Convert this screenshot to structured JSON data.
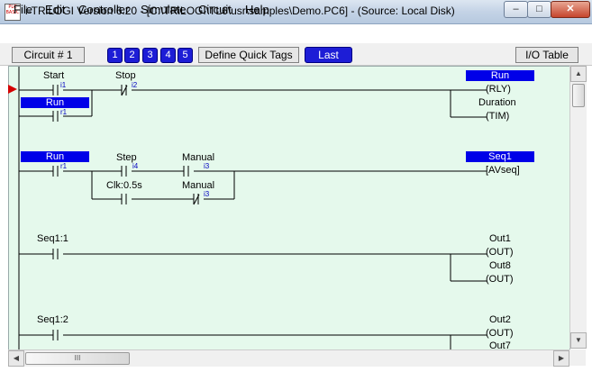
{
  "window": {
    "title": "i-TRiLOGI Version 6.20 - [C:\\TRiLOGI\\TL6\\usr\\samples\\Demo.PC6] - (Source: Local Disk)",
    "icon_text": "PLC BASIC",
    "minimize": "–",
    "maximize": "□",
    "close": "✕"
  },
  "menu": [
    "File",
    "Edit",
    "Controller",
    "Simulate",
    "Circuit",
    "Help"
  ],
  "toolbar": {
    "circuit_label": "Circuit # 1",
    "quick_tags": [
      "1",
      "2",
      "3",
      "4",
      "5"
    ],
    "define_quick_tags": "Define Quick Tags",
    "last": "Last",
    "io_table": "I/O Table"
  },
  "ladder": {
    "rung1": {
      "contact1": {
        "label": "Start",
        "tag": "i1"
      },
      "contact2": {
        "label": "Stop",
        "tag": "i2"
      },
      "branch_contact": {
        "label": "Run",
        "tag": "r1"
      },
      "coil1": {
        "label": "Run",
        "type": "(RLY)"
      },
      "coil2": {
        "label": "Duration",
        "type": "(TIM)"
      }
    },
    "rung2": {
      "contact1": {
        "label": "Run",
        "tag": "r1"
      },
      "contact2": {
        "label": "Step",
        "tag": "i4"
      },
      "contact3": {
        "label": "Manual",
        "tag": "i3"
      },
      "contact4": {
        "label": "Clk:0.5s",
        "tag": ""
      },
      "contact5": {
        "label": "Manual",
        "tag": "i3"
      },
      "coil": {
        "label": "Seq1",
        "type": "[AVseq]"
      }
    },
    "rung3": {
      "contact": {
        "label": "Seq1:1"
      },
      "coil1": {
        "label": "Out1",
        "type": "(OUT)"
      },
      "coil2": {
        "label": "Out8",
        "type": "(OUT)"
      }
    },
    "rung4": {
      "contact": {
        "label": "Seq1:2"
      },
      "coil1": {
        "label": "Out2",
        "type": "(OUT)"
      },
      "coil2": {
        "label": "Out7",
        "type": ""
      }
    }
  },
  "scroll": {
    "up": "▲",
    "down": "▼",
    "left": "◀",
    "right": "▶",
    "grip": "III"
  },
  "colors": {
    "highlight": "#0000e8",
    "ladder_bg": "#e5f9ec",
    "rung_marker": "#d40000"
  }
}
